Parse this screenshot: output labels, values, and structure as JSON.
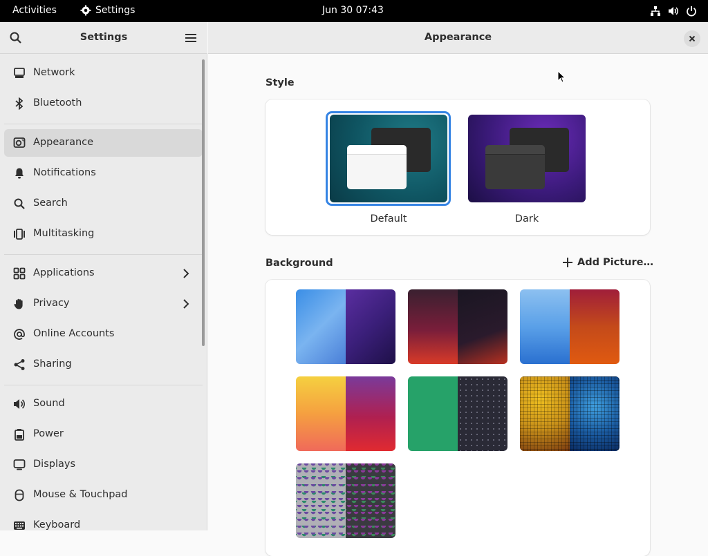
{
  "topbar": {
    "activities": "Activities",
    "app_name": "Settings",
    "clock": "Jun 30  07:43",
    "icons": [
      "network-wired-icon",
      "volume-icon",
      "power-icon"
    ]
  },
  "sidebar": {
    "title": "Settings",
    "items": [
      {
        "label": "Network",
        "icon": "network-icon"
      },
      {
        "label": "Bluetooth",
        "icon": "bluetooth-icon"
      },
      {
        "label": "Appearance",
        "icon": "appearance-icon"
      },
      {
        "label": "Notifications",
        "icon": "bell-icon"
      },
      {
        "label": "Search",
        "icon": "search-icon"
      },
      {
        "label": "Multitasking",
        "icon": "multitasking-icon"
      },
      {
        "label": "Applications",
        "icon": "applications-icon"
      },
      {
        "label": "Privacy",
        "icon": "hand-icon"
      },
      {
        "label": "Online Accounts",
        "icon": "at-icon"
      },
      {
        "label": "Sharing",
        "icon": "share-icon"
      },
      {
        "label": "Sound",
        "icon": "speaker-icon"
      },
      {
        "label": "Power",
        "icon": "battery-icon"
      },
      {
        "label": "Displays",
        "icon": "display-icon"
      },
      {
        "label": "Mouse & Touchpad",
        "icon": "mouse-icon"
      },
      {
        "label": "Keyboard",
        "icon": "keyboard-icon"
      }
    ],
    "active": "Appearance"
  },
  "main": {
    "title": "Appearance",
    "style": {
      "heading": "Style",
      "options": [
        {
          "label": "Default",
          "selected": true
        },
        {
          "label": "Dark",
          "selected": false
        }
      ]
    },
    "background": {
      "heading": "Background",
      "add_label": "Add Picture…",
      "wallpapers": [
        {
          "name": "blobs",
          "light": "#5aa0e8",
          "dark": "#3b1f7a"
        },
        {
          "name": "pixels",
          "light": "#7a1e3a",
          "dark": "#1c1826"
        },
        {
          "name": "drool",
          "light": "#4a94e0",
          "dark": "#c44a1a"
        },
        {
          "name": "gradient",
          "light": "#f5a040",
          "dark": "#b02050"
        },
        {
          "name": "symbolic",
          "light": "#26a269",
          "dark": "#2a2a36"
        },
        {
          "name": "sequins",
          "light": "#c8901a",
          "dark": "#1a5aa0"
        },
        {
          "name": "scales",
          "light": "#9a9aa0",
          "dark": "#3a3a40"
        }
      ]
    }
  },
  "colors": {
    "accent": "#3584e4",
    "sidebar_bg": "#ebebeb",
    "selected_row": "#d9d9d9"
  }
}
